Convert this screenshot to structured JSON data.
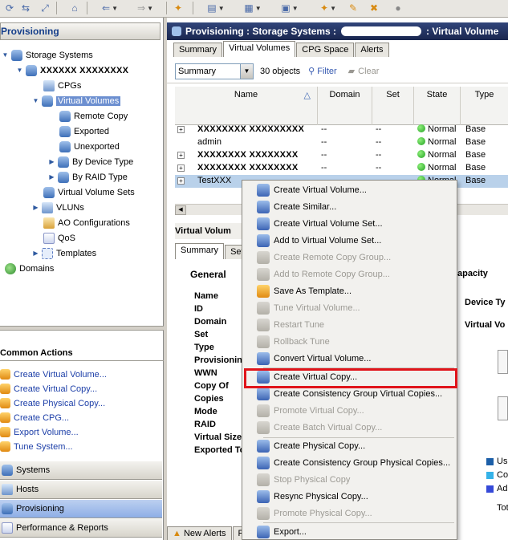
{
  "toolbar": {
    "buttons": [
      "back-arrow",
      "forward-arrow",
      "home",
      "refresh",
      "storage",
      "volumes",
      "hosts",
      "provision",
      "edit",
      "delete"
    ]
  },
  "left": {
    "header": "Provisioning",
    "tree": [
      {
        "label": "Storage Systems",
        "icon": "storage-icon"
      },
      {
        "label": "XXXXXX XXXXXXXX",
        "icon": "system-icon"
      },
      {
        "label": "CPGs",
        "icon": "cpg-icon"
      },
      {
        "label": "Virtual Volumes",
        "icon": "virtual-volumes-icon"
      },
      {
        "label": "Remote Copy",
        "icon": "volume-icon"
      },
      {
        "label": "Exported",
        "icon": "volume-icon"
      },
      {
        "label": "Unexported",
        "icon": "volume-icon"
      },
      {
        "label": "By Device Type",
        "icon": "volume-icon"
      },
      {
        "label": "By RAID Type",
        "icon": "volume-icon"
      },
      {
        "label": "Virtual Volume Sets",
        "icon": "volume-set-icon"
      },
      {
        "label": "VLUNs",
        "icon": "vlun-icon"
      },
      {
        "label": "AO Configurations",
        "icon": "ao-icon"
      },
      {
        "label": "QoS",
        "icon": "qos-icon"
      },
      {
        "label": "Templates",
        "icon": "template-icon"
      },
      {
        "label": "Domains",
        "icon": "domain-icon"
      }
    ],
    "common_actions_title": "Common Actions",
    "common_actions": [
      "Create Virtual Volume...",
      "Create Virtual Copy...",
      "Create Physical Copy...",
      "Create CPG...",
      "Export Volume...",
      "Tune System..."
    ],
    "nav": [
      "Systems",
      "Hosts",
      "Provisioning",
      "Performance & Reports"
    ]
  },
  "right": {
    "title_prefix": "Provisioning : Storage Systems :",
    "title_suffix": ": Virtual Volume",
    "tabs": [
      "Summary",
      "Virtual Volumes",
      "CPG Space",
      "Alerts"
    ],
    "filter": {
      "view": "Summary",
      "count": "30 objects",
      "filter_label": "Filter",
      "clear_label": "Clear"
    },
    "columns": [
      "Name",
      "Domain",
      "Set",
      "State",
      "Type"
    ],
    "rows": [
      {
        "name": "XXXXXXXX XXXXXXXXX",
        "domain": "--",
        "set": "--",
        "state": "Normal",
        "type": "Base"
      },
      {
        "name": "admin",
        "domain": "--",
        "set": "--",
        "state": "Normal",
        "type": "Base"
      },
      {
        "name": "XXXXXXXX XXXXXXXX",
        "domain": "--",
        "set": "--",
        "state": "Normal",
        "type": "Base"
      },
      {
        "name": "XXXXXXXX XXXXXXXX",
        "domain": "--",
        "set": "--",
        "state": "Normal",
        "type": "Base"
      },
      {
        "name": "TestXXX",
        "domain": "",
        "set": "",
        "state": "Normal",
        "type": "Base"
      }
    ],
    "detail_title": "Virtual Volum",
    "detail_tabs": [
      "Summary",
      "Sett"
    ],
    "general_title": "General",
    "general_fields": [
      "Name",
      "ID",
      "Domain",
      "Set",
      "Type",
      "Provisioning",
      "WWN",
      "Copy Of",
      "Copies",
      "Mode",
      "RAID",
      "Virtual Size",
      "Exported To"
    ],
    "capacity_title": "apacity",
    "device_type_label": "Device Ty",
    "virtual_vol_label": "Virtual Vo",
    "legend": [
      {
        "label": "Use",
        "color": "#1c5fa8"
      },
      {
        "label": "Co",
        "color": "#35b2e8"
      },
      {
        "label": "Ad",
        "color": "#3549d8"
      }
    ],
    "tot_label": "Tot",
    "alerts_tab": "New Alerts",
    "alerts_tab2": "R"
  },
  "context_menu": {
    "items": [
      {
        "label": "Create Virtual Volume...",
        "enabled": true
      },
      {
        "label": "Create Similar...",
        "enabled": true
      },
      {
        "label": "Create Virtual Volume Set...",
        "enabled": true
      },
      {
        "label": "Add to Virtual Volume Set...",
        "enabled": true
      },
      {
        "label": "Create Remote Copy Group...",
        "enabled": false
      },
      {
        "label": "Add to Remote Copy Group...",
        "enabled": false
      },
      {
        "label": "Save As Template...",
        "enabled": true
      },
      {
        "label": "Tune Virtual Volume...",
        "enabled": false
      },
      {
        "label": "Restart Tune",
        "enabled": false
      },
      {
        "label": "Rollback Tune",
        "enabled": false
      },
      {
        "label": "Convert Virtual Volume...",
        "enabled": true
      },
      {
        "label": "Create Virtual Copy...",
        "enabled": true
      },
      {
        "label": "Create Consistency Group Virtual Copies...",
        "enabled": true
      },
      {
        "label": "Promote Virtual Copy...",
        "enabled": false
      },
      {
        "label": "Create Batch Virtual Copy...",
        "enabled": false
      },
      {
        "label": "Create Physical Copy...",
        "enabled": true
      },
      {
        "label": "Create Consistency Group Physical Copies...",
        "enabled": true
      },
      {
        "label": "Stop Physical Copy",
        "enabled": false
      },
      {
        "label": "Resync Physical Copy...",
        "enabled": true
      },
      {
        "label": "Promote Physical Copy...",
        "enabled": false
      },
      {
        "label": "Export...",
        "enabled": true
      }
    ],
    "highlighted": "Create Virtual Copy...",
    "highlight_color": "#e0141a"
  }
}
